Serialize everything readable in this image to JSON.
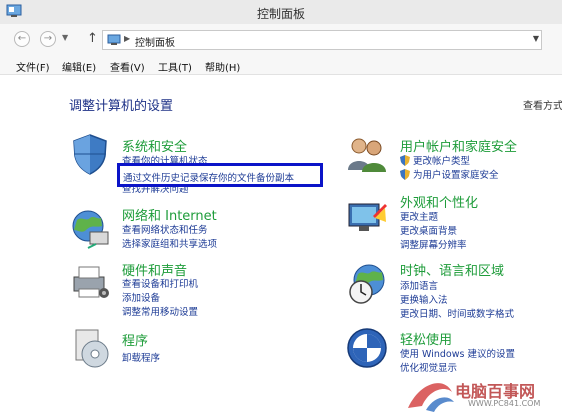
{
  "window": {
    "title": "控制面板"
  },
  "nav": {
    "back_glyph": "←",
    "forward_glyph": "→",
    "up_glyph": "↑",
    "dropdown_glyph": "▼",
    "sep_glyph": "▶"
  },
  "address": {
    "path": "控制面板"
  },
  "menu": [
    "文件(F)",
    "编辑(E)",
    "查看(V)",
    "工具(T)",
    "帮助(H)"
  ],
  "main": {
    "heading": "调整计算机的设置",
    "view_by": "查看方式"
  },
  "categories": {
    "system": {
      "title": "系统和安全",
      "links": [
        "查看你的计算机状态",
        "通过文件历史记录保存你的文件备份副本",
        "查找并解决问题"
      ]
    },
    "network": {
      "title": "网络和 Internet",
      "links": [
        "查看网络状态和任务",
        "选择家庭组和共享选项"
      ]
    },
    "hardware": {
      "title": "硬件和声音",
      "links": [
        "查看设备和打印机",
        "添加设备",
        "调整常用移动设置"
      ]
    },
    "programs": {
      "title": "程序",
      "links": [
        "卸载程序"
      ]
    },
    "users": {
      "title": "用户帐户和家庭安全",
      "links": [
        "更改帐户类型",
        "为用户设置家庭安全"
      ]
    },
    "appearance": {
      "title": "外观和个性化",
      "links": [
        "更改主题",
        "更改桌面背景",
        "调整屏幕分辨率"
      ]
    },
    "clock": {
      "title": "时钟、语言和区域",
      "links": [
        "添加语言",
        "更换输入法",
        "更改日期、时间或数字格式"
      ]
    },
    "ease": {
      "title": "轻松使用",
      "links": [
        "使用 Windows 建议的设置",
        "优化视觉显示"
      ]
    }
  },
  "watermark": {
    "text": "电脑百事网",
    "url": "WWW.PC841.COM"
  },
  "colors": {
    "category_title": "#1e9c3a",
    "link": "#1e3c96",
    "highlight_border": "#0b14c8",
    "heading": "#1e3287"
  }
}
